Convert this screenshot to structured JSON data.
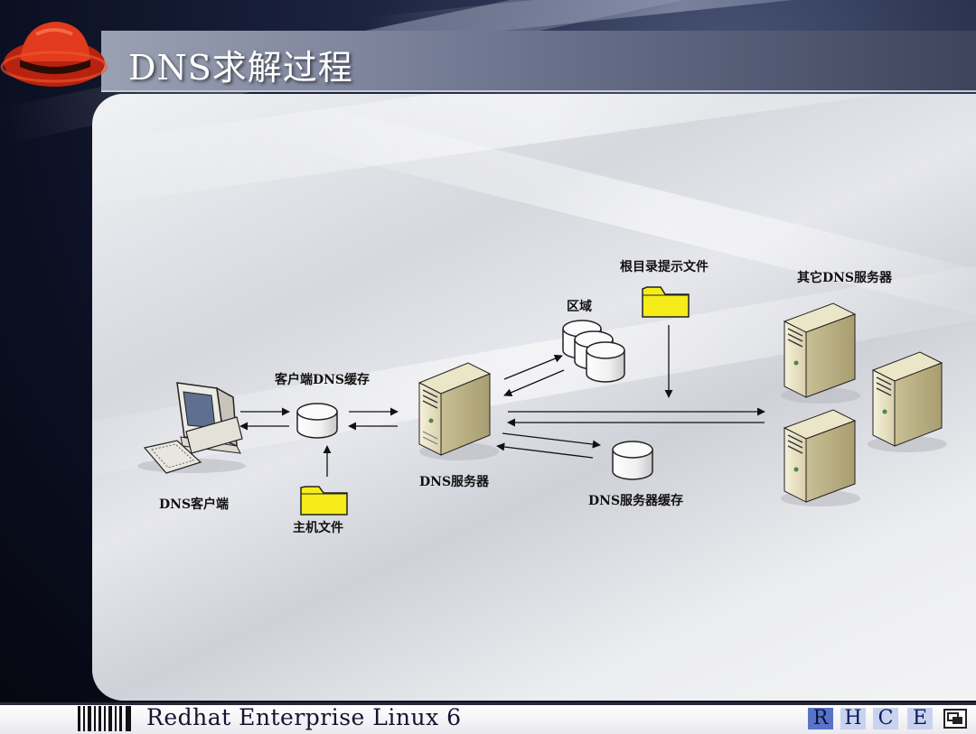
{
  "slide": {
    "title": "DNS求解过程",
    "footer_text": "Redhat Enterprise Linux 6",
    "badge_letters": [
      "R",
      "H",
      "C",
      "E"
    ]
  },
  "diagram": {
    "nodes": {
      "client": "DNS客户端",
      "client_cache": "客户端DNS缓存",
      "hosts_file": "主机文件",
      "dns_server": "DNS服务器",
      "zone": "区域",
      "root_hints": "根目录提示文件",
      "server_cache": "DNS服务器缓存",
      "other_servers": "其它DNS服务器"
    }
  },
  "colors": {
    "folder": "#f5ec1a",
    "hat": "#d8301a",
    "title_text": "#ffffff"
  }
}
